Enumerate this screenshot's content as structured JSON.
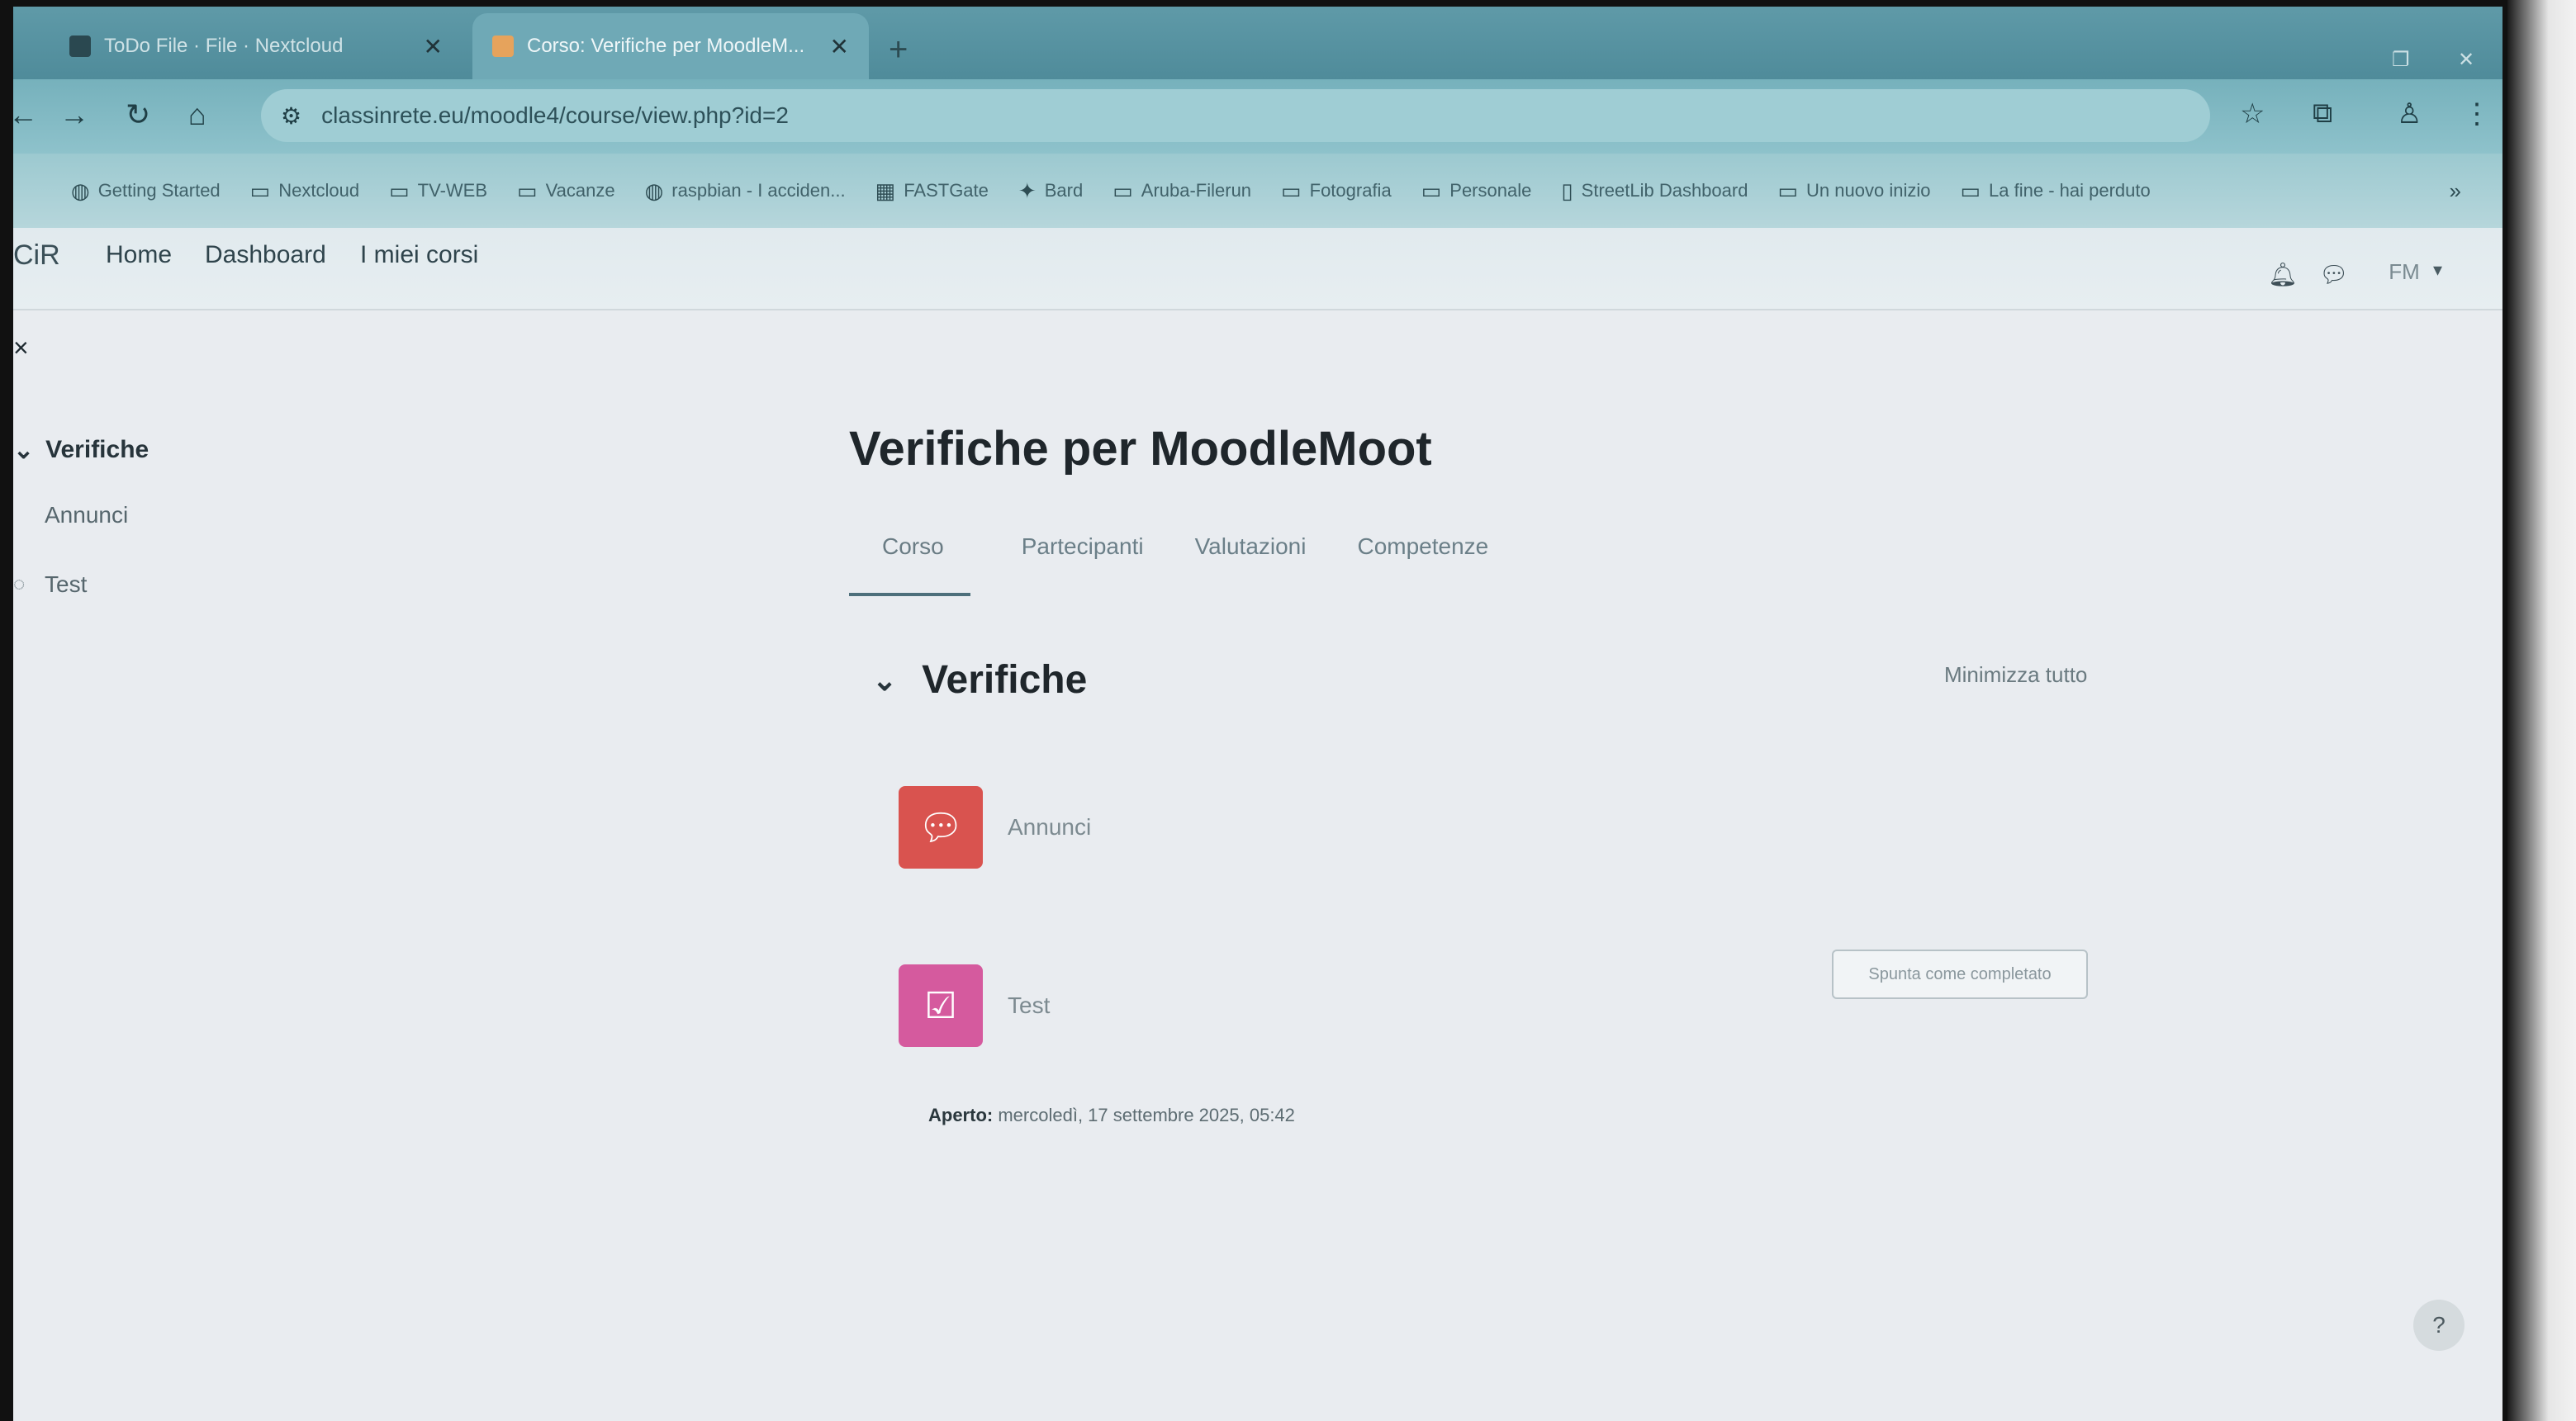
{
  "browser": {
    "tabs": [
      {
        "title": "ToDo File · File · Nextcloud",
        "active": false
      },
      {
        "title": "Corso: Verifiche per MoodleM...",
        "active": true
      }
    ],
    "new_tab": "+",
    "url": "classinrete.eu/moodle4/course/view.php?id=2",
    "bookmarks": [
      {
        "label": "Getting Started",
        "icon": "globe-icon"
      },
      {
        "label": "Nextcloud",
        "icon": "folder-icon"
      },
      {
        "label": "TV-WEB",
        "icon": "folder-icon"
      },
      {
        "label": "Vacanze",
        "icon": "folder-icon"
      },
      {
        "label": "raspbian - I acciden...",
        "icon": "globe-icon"
      },
      {
        "label": "FASTGate",
        "icon": "page-icon"
      },
      {
        "label": "Bard",
        "icon": "sparkle-icon"
      },
      {
        "label": "Aruba-Filerun",
        "icon": "folder-icon"
      },
      {
        "label": "Fotografia",
        "icon": "folder-icon"
      },
      {
        "label": "Personale",
        "icon": "folder-icon"
      },
      {
        "label": "StreetLib Dashboard",
        "icon": "page-icon"
      },
      {
        "label": "Un nuovo inizio",
        "icon": "folder-icon"
      },
      {
        "label": "La fine - hai perduto",
        "icon": "folder-icon"
      }
    ],
    "more": "»"
  },
  "navbar": {
    "brand": "CiR",
    "links": [
      "Home",
      "Dashboard",
      "I miei corsi"
    ],
    "avatar_initials": "FM"
  },
  "course_index": {
    "close_icon": "×",
    "section": "Verifiche",
    "items": [
      "Annunci",
      "Test"
    ]
  },
  "page": {
    "title": "Verifiche per MoodleMoot",
    "tabs": [
      "Corso",
      "Partecipanti",
      "Valutazioni",
      "Competenze"
    ],
    "collapse_all": "Minimizza tutto"
  },
  "section": {
    "name": "Verifiche",
    "activities": [
      {
        "name": "Annunci",
        "type": "forum",
        "color": "#d9534f"
      },
      {
        "name": "Test",
        "type": "quiz",
        "color": "#d55a9e",
        "button": "Spunta come completato"
      }
    ],
    "dates_label": "Aperto:",
    "dates_value": "mercoledì, 17 settembre 2025, 05:42"
  },
  "help": "?"
}
